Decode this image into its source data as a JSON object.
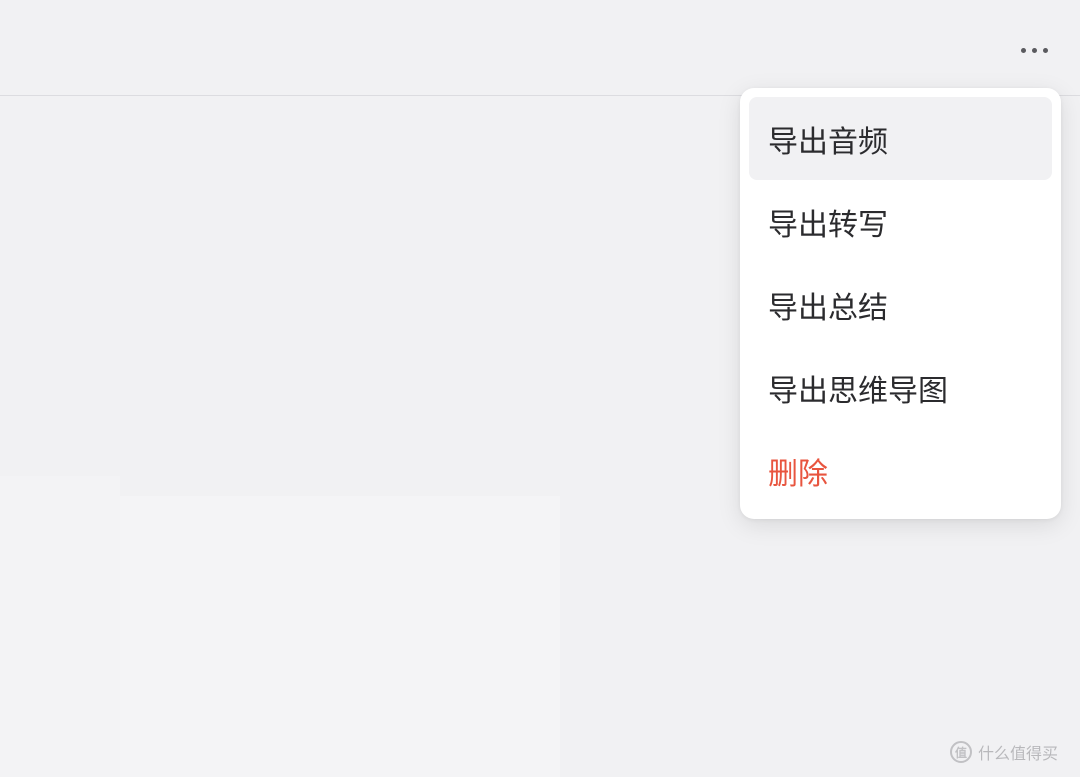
{
  "toolbar": {
    "more_icon": "more-horizontal-icon"
  },
  "menu": {
    "items": [
      {
        "label": "导出音频",
        "state": "hover"
      },
      {
        "label": "导出转写",
        "state": "normal"
      },
      {
        "label": "导出总结",
        "state": "normal"
      },
      {
        "label": "导出思维导图",
        "state": "normal"
      },
      {
        "label": "删除",
        "state": "danger"
      }
    ],
    "danger_color": "#e8553f"
  },
  "watermark": {
    "logo_glyph": "值",
    "text": "什么值得买"
  }
}
